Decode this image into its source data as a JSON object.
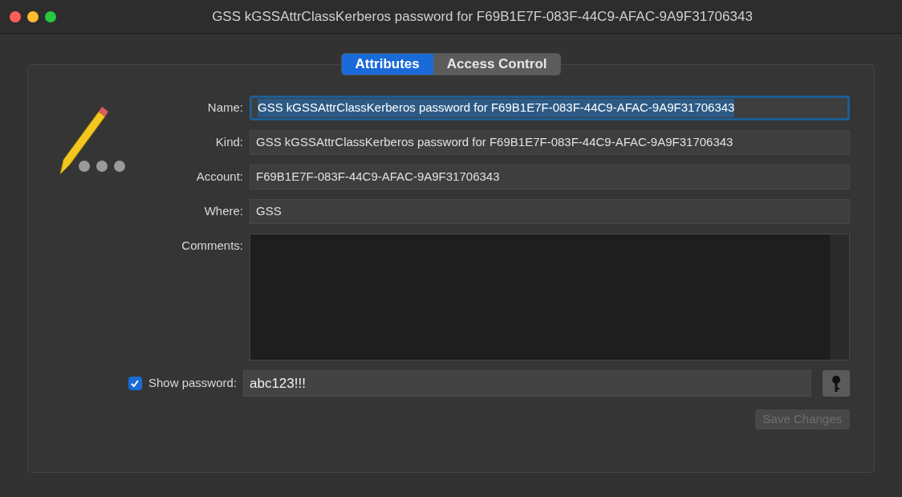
{
  "window": {
    "title": "GSS kGSSAttrClassKerberos password for F69B1E7F-083F-44C9-AFAC-9A9F31706343"
  },
  "tabs": [
    {
      "label": "Attributes",
      "selected": true
    },
    {
      "label": "Access Control",
      "selected": false
    }
  ],
  "fields": [
    {
      "label": "Name:",
      "value": "GSS kGSSAttrClassKerberos password for F69B1E7F-083F-44C9-AFAC-9A9F31706343",
      "focused": true
    },
    {
      "label": "Kind:",
      "value": "GSS kGSSAttrClassKerberos password for F69B1E7F-083F-44C9-AFAC-9A9F31706343",
      "focused": false
    },
    {
      "label": "Account:",
      "value": "F69B1E7F-083F-44C9-AFAC-9A9F31706343",
      "focused": false
    },
    {
      "label": "Where:",
      "value": "GSS",
      "focused": false
    }
  ],
  "comments": {
    "label": "Comments:"
  },
  "show_password": {
    "label": "Show password:",
    "checked": true,
    "value": "abc123!!!"
  },
  "save_button": {
    "label": "Save Changes",
    "disabled": true
  }
}
